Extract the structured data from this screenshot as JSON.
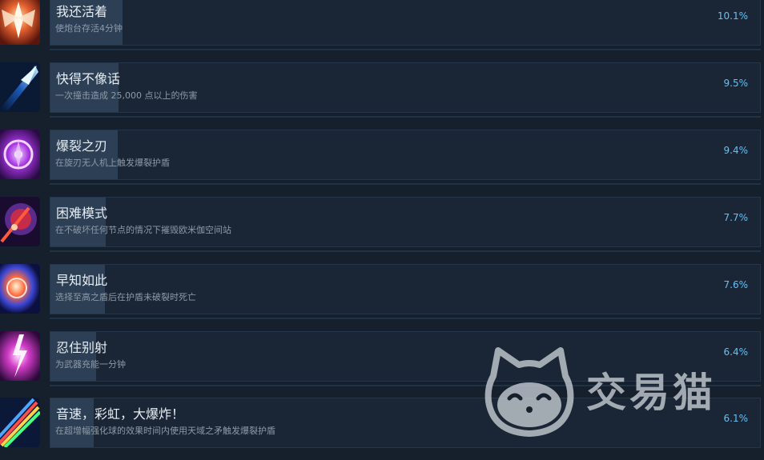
{
  "achievements": [
    {
      "title": "我还活着",
      "description": "使炮台存活4分钟",
      "percent": "10.1%",
      "percent_value": 10.1,
      "icon": "winged-emblem-icon",
      "accent": "#d9573b"
    },
    {
      "title": "快得不像话",
      "description": "一次撞击造成 25,000 点以上的伤害",
      "percent": "9.5%",
      "percent_value": 9.5,
      "icon": "blue-comet-icon",
      "accent": "#2f8de0"
    },
    {
      "title": "爆裂之刃",
      "description": "在旋刃无人机上触发爆裂护盾",
      "percent": "9.4%",
      "percent_value": 9.4,
      "icon": "purple-blade-disc-icon",
      "accent": "#9b3fd6"
    },
    {
      "title": "困难模式",
      "description": "在不破坏任何节点的情况下摧毁欧米伽空间站",
      "percent": "7.7%",
      "percent_value": 7.7,
      "icon": "crimson-orb-icon",
      "accent": "#7a2fa0"
    },
    {
      "title": "早知如此",
      "description": "选择至高之盾后在护盾未破裂时死亡",
      "percent": "7.6%",
      "percent_value": 7.6,
      "icon": "glowing-sphere-icon",
      "accent": "#3a4fd0"
    },
    {
      "title": "忍住别射",
      "description": "为武器充能一分钟",
      "percent": "6.4%",
      "percent_value": 6.4,
      "icon": "pink-lightning-icon",
      "accent": "#c02ab8"
    },
    {
      "title": "音速，彩虹，大爆炸！",
      "description": "在超增幅强化球的效果时间内使用天域之矛触发爆裂护盾",
      "percent": "6.1%",
      "percent_value": 6.1,
      "icon": "rainbow-streak-icon",
      "accent": "#2a6fd6"
    }
  ],
  "watermark": {
    "text": "交易猫",
    "logo": "cat-face-logo-icon"
  },
  "colors": {
    "background": "#16202d",
    "card": "#1a2635",
    "progress_fill": "#2d3f55",
    "percent": "#66c0f4",
    "title": "#e6edf3",
    "description": "#8e9aa7"
  }
}
